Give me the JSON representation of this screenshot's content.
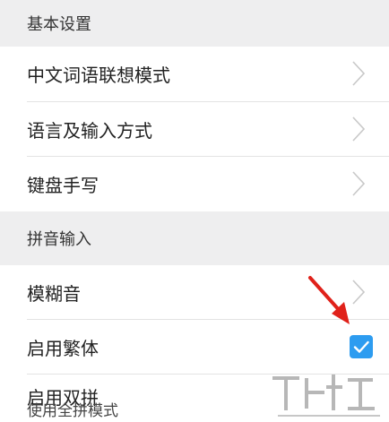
{
  "sections": [
    {
      "header": "基本设置",
      "items": [
        {
          "label": "中文词语联想模式",
          "control": "chevron"
        },
        {
          "label": "语言及输入方式",
          "control": "chevron"
        },
        {
          "label": "键盘手写",
          "control": "chevron"
        }
      ]
    },
    {
      "header": "拼音输入",
      "items": [
        {
          "label": "模糊音",
          "control": "chevron"
        },
        {
          "label": "启用繁体",
          "control": "checkbox",
          "checked": true
        },
        {
          "label": "启用双拼",
          "control": "none",
          "subtext": "使用全拼模式"
        }
      ]
    }
  ],
  "colors": {
    "section_background": "#eeeeef",
    "checkbox_accent": "#2d9cf0",
    "annotation_arrow": "#e0211a"
  },
  "icons": {
    "chevron": "chevron-right-icon",
    "checkbox": "checkmark-icon",
    "annotation": "red-arrow-icon"
  }
}
